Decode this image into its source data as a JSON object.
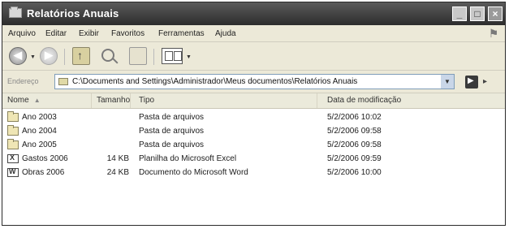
{
  "window": {
    "title": "Relatórios Anuais",
    "buttons": {
      "minimize": "_",
      "maximize": "□",
      "close": "×"
    }
  },
  "menu": [
    "Arquivo",
    "Editar",
    "Exibir",
    "Favoritos",
    "Ferramentas",
    "Ajuda"
  ],
  "toolbar": {
    "back_icon": "back-arrow-icon",
    "forward_icon": "forward-arrow-icon",
    "up_icon": "folder-up-icon",
    "search_icon": "search-icon",
    "folders_icon": "folders-icon",
    "views_icon": "views-icon"
  },
  "address": {
    "label": "Endereço",
    "value": "C:\\Documents and Settings\\Administrador\\Meus documentos\\Relatórios Anuais",
    "go_label": "Ir"
  },
  "columns": {
    "name": "Nome",
    "size": "Tamanho",
    "type": "Tipo",
    "date": "Data de modificação"
  },
  "files": [
    {
      "name": "Ano 2003",
      "size": "",
      "type": "Pasta de arquivos",
      "date": "5/2/2006 10:02",
      "icon": "folder"
    },
    {
      "name": "Ano 2004",
      "size": "",
      "type": "Pasta de arquivos",
      "date": "5/2/2006 09:58",
      "icon": "folder"
    },
    {
      "name": "Ano 2005",
      "size": "",
      "type": "Pasta de arquivos",
      "date": "5/2/2006 09:58",
      "icon": "folder"
    },
    {
      "name": "Gastos 2006",
      "size": "14 KB",
      "type": "Planilha do Microsoft Excel",
      "date": "5/2/2006 09:59",
      "icon": "excel"
    },
    {
      "name": "Obras 2006",
      "size": "24 KB",
      "type": "Documento do Microsoft Word",
      "date": "5/2/2006 10:00",
      "icon": "word"
    }
  ]
}
